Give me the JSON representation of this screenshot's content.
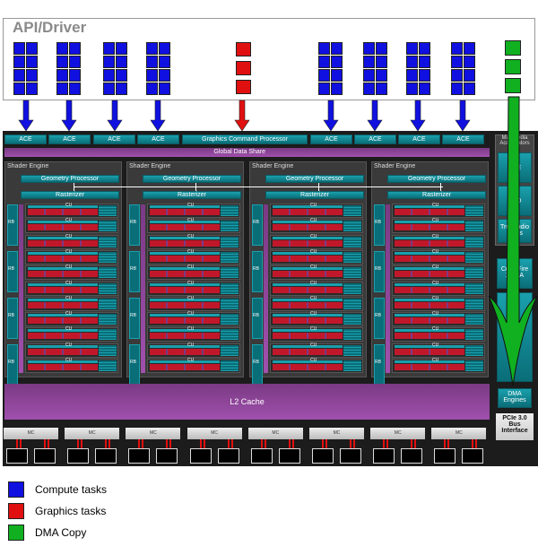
{
  "api": {
    "title": "API/Driver"
  },
  "colors": {
    "compute": "#1010e0",
    "graphics": "#e01010",
    "dma": "#10b020"
  },
  "top_row": {
    "ace": "ACE",
    "gcp": "Graphics Command Processor"
  },
  "global_data_share": "Global Data Share",
  "shader_engine": {
    "title": "Shader Engine",
    "geometry": "Geometry Processor",
    "rasterizer": "Rasterizer",
    "cu": "CU",
    "rb": "RB"
  },
  "l2_cache": "L2 Cache",
  "mc": "MC",
  "side": {
    "multimedia": "Multimedia Accelerators",
    "vce": "VCE",
    "uvd": "UVD",
    "trueaudio": "TrueAudio DSPs",
    "crossfire": "CrossFire XDMA",
    "dma": "DMA Engines",
    "pcie": "PCIe 3.0 Bus Interface"
  },
  "legend": [
    {
      "label": "Compute tasks",
      "color": "#1010e0"
    },
    {
      "label": "Graphics tasks",
      "color": "#e01010"
    },
    {
      "label": "DMA Copy",
      "color": "#10b020"
    }
  ]
}
